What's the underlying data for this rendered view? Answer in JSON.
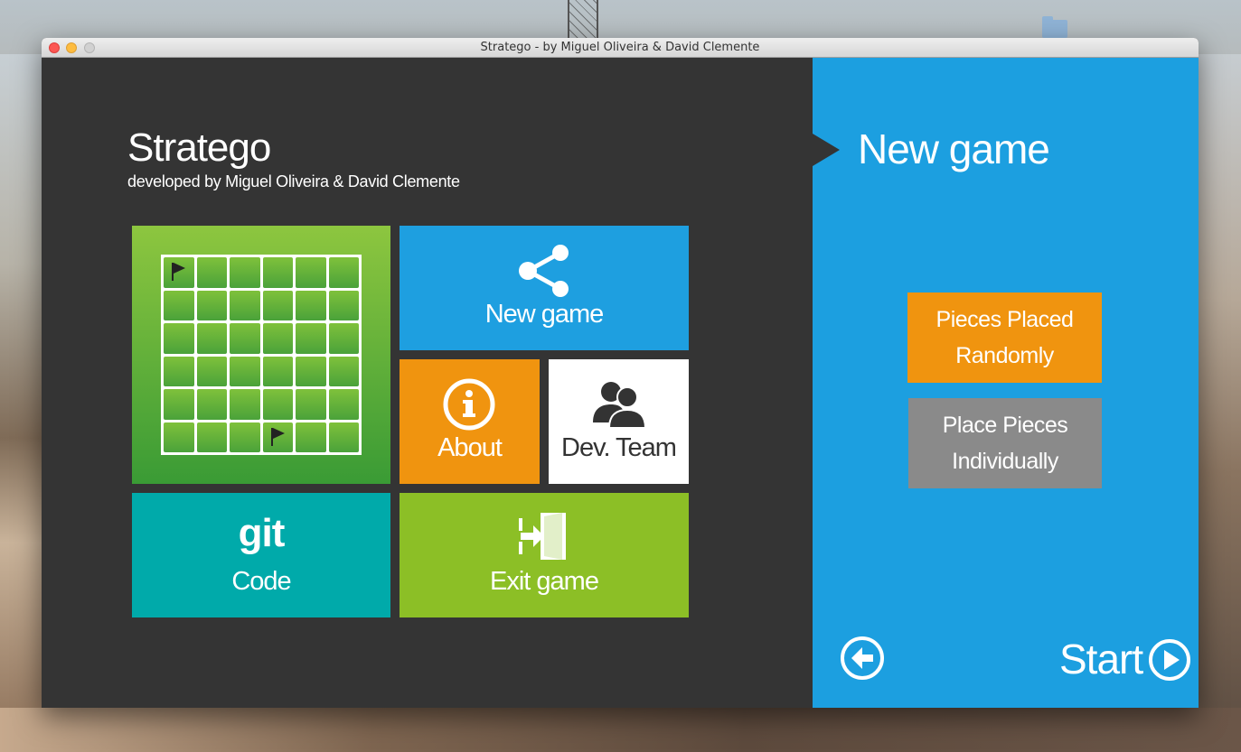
{
  "window": {
    "title": "Stratego - by Miguel Oliveira & David Clemente"
  },
  "header": {
    "title": "Stratego",
    "subtitle": "developed by Miguel Oliveira & David Clemente"
  },
  "tiles": {
    "new_game": {
      "label": "New game",
      "icon": "share-icon"
    },
    "about": {
      "label": "About",
      "icon": "info-icon"
    },
    "dev_team": {
      "label": "Dev. Team",
      "icon": "users-icon"
    },
    "code": {
      "logo": "git",
      "label": "Code"
    },
    "exit": {
      "label": "Exit game",
      "icon": "exit-door-icon"
    }
  },
  "board": {
    "rows": 6,
    "cols": 6,
    "flags": [
      "row1-col1",
      "row6-col4"
    ]
  },
  "panel": {
    "title": "New game",
    "options": [
      "Pieces Placed Randomly",
      "Place Pieces Individually"
    ],
    "start_label": "Start",
    "back_icon": "back-arrow-icon",
    "start_icon": "play-icon"
  },
  "colors": {
    "background": "#343434",
    "panel_blue": "#1c9fe0",
    "orange": "#f0940f",
    "green": "#8cbf26",
    "teal": "#00aaaa",
    "gray": "#8a8a8a"
  }
}
